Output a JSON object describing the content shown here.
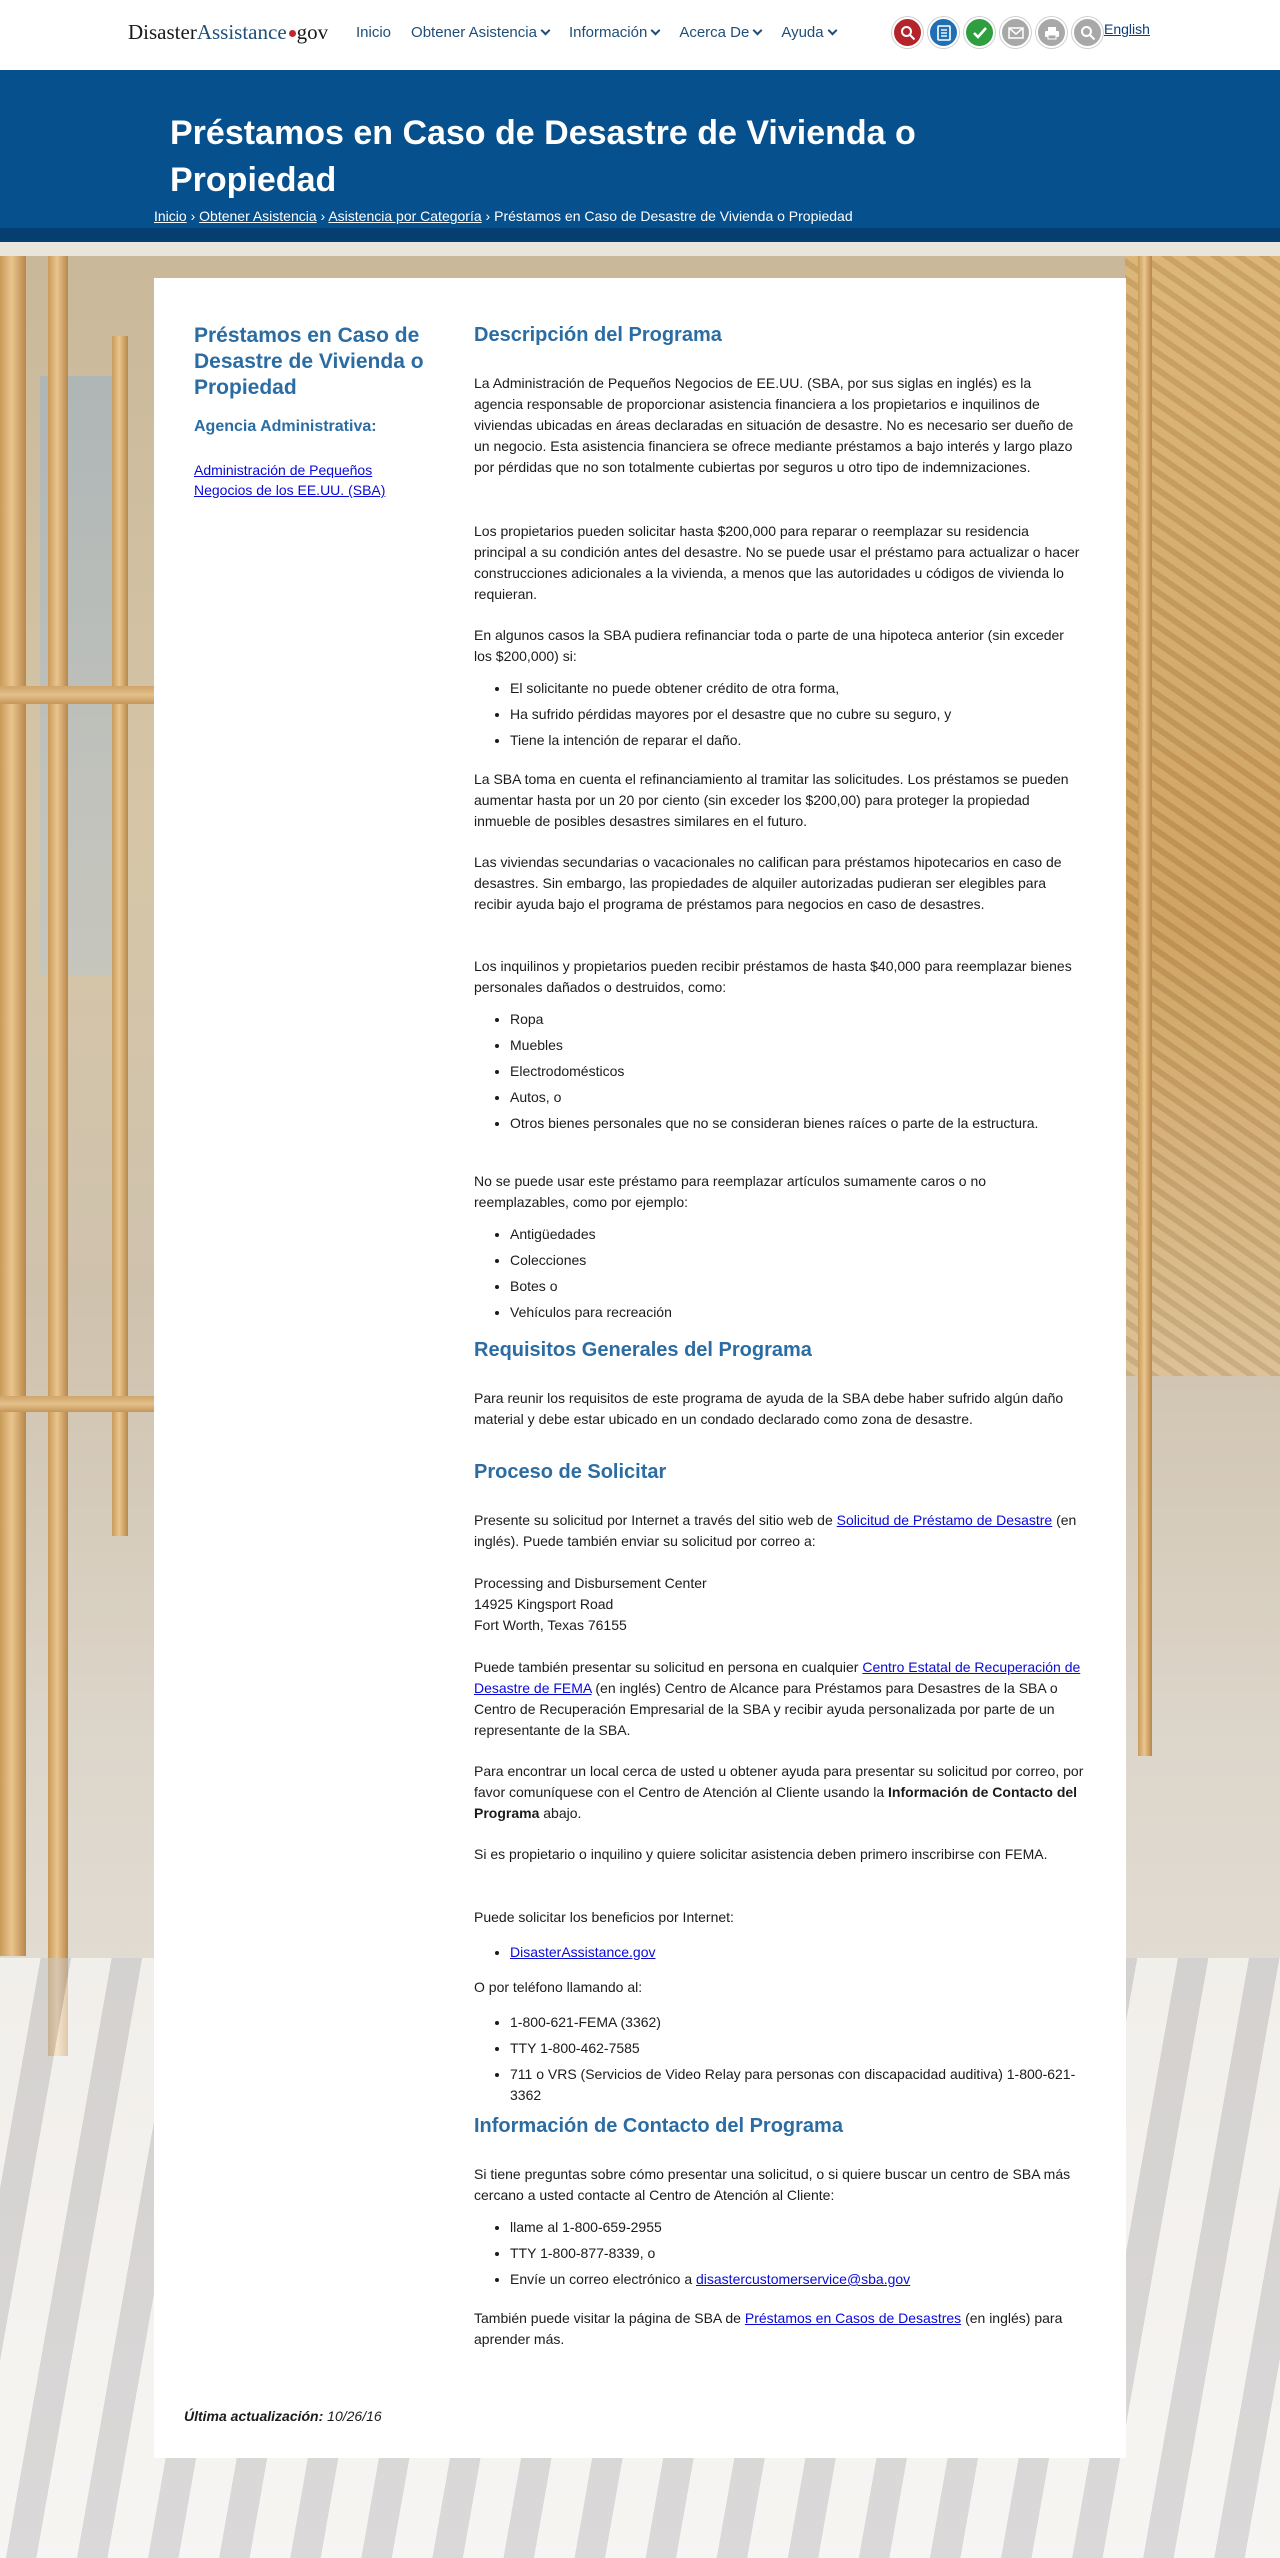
{
  "header": {
    "logo_part1": "Disaster",
    "logo_part2": "Assistance",
    "logo_part3": "gov",
    "nav": [
      "Inicio",
      "Obtener Asistencia",
      "Información",
      "Acerca De",
      "Ayuda"
    ],
    "language_link": "English"
  },
  "hero": {
    "title": "Préstamos en Caso de Desastre de Vivienda o Propiedad",
    "breadcrumb": {
      "home": "Inicio",
      "get_assistance": "Obtener Asistencia",
      "by_category": "Asistencia por Categoría",
      "current": "Préstamos en Caso de Desastre de Vivienda o Propiedad",
      "separator": "›"
    }
  },
  "sidebar": {
    "title": "Préstamos en Caso de Desastre de Vivienda o Propiedad",
    "agency_heading": "Agencia Administrativa:",
    "agency_link": "Administración de Pequeños Negocios de los EE.UU. (SBA)"
  },
  "main": {
    "h_description": "Descripción del Programa",
    "p1": "La Administración de Pequeños Negocios de EE.UU. (SBA, por sus siglas en inglés) es la agencia responsable de proporcionar asistencia financiera a los propietarios e inquilinos de viviendas ubicadas en áreas declaradas en situación de desastre. No es necesario ser dueño de un negocio. Esta asistencia financiera se ofrece mediante préstamos a bajo interés y largo plazo por pérdidas que no son totalmente cubiertas por seguros u otro tipo de indemnizaciones.",
    "p2": "Los propietarios pueden solicitar hasta $200,000 para reparar o reemplazar su residencia principal a su condición antes del desastre. No se puede usar el préstamo para actualizar o hacer construcciones adicionales a la vivienda, a menos que las autoridades u códigos de vivienda lo requieran.",
    "p3": "En algunos casos la SBA pudiera refinanciar toda o parte de una hipoteca anterior (sin exceder los $200,000) si:",
    "list1": [
      "El solicitante no puede obtener crédito de otra forma,",
      "Ha sufrido pérdidas mayores por el desastre que no cubre su seguro, y",
      "Tiene la intención de reparar el daño."
    ],
    "p4": "La SBA toma en cuenta el refinanciamiento al tramitar las solicitudes. Los préstamos se pueden aumentar hasta por un 20 por ciento (sin exceder los $200,00) para proteger la propiedad inmueble de posibles desastres similares en el futuro.",
    "p5": "Las viviendas secundarias o vacacionales no califican para préstamos hipotecarios en caso de desastres. Sin embargo, las propiedades de alquiler autorizadas pudieran ser elegibles para recibir ayuda bajo el programa de préstamos para negocios en caso de desastres.",
    "p6": "Los inquilinos y propietarios pueden recibir préstamos de hasta $40,000 para reemplazar bienes personales dañados o destruidos, como:",
    "list2": [
      "Ropa",
      "Muebles",
      "Electrodomésticos",
      "Autos, o",
      "Otros bienes personales que no se consideran bienes raíces o parte de la estructura."
    ],
    "p7": "No se puede usar este préstamo para reemplazar artículos sumamente caros o no reemplazables, como por ejemplo:",
    "list3": [
      "Antigüedades",
      "Colecciones",
      "Botes o",
      "Vehículos para recreación"
    ],
    "h_requirements": "Requisitos Generales del Programa",
    "p8": "Para reunir los requisitos de este programa de ayuda de la SBA debe haber sufrido algún daño material y debe estar ubicado en un condado declarado como zona de desastre.",
    "h_process": "Proceso de Solicitar",
    "p9_a": "Presente su solicitud por Internet a través del sitio web de ",
    "p9_link": "Solicitud de Préstamo de Desastre",
    "p9_b": " (en inglés). Puede también enviar su solicitud por correo a:",
    "address": [
      "Processing and Disbursement Center",
      "14925 Kingsport Road",
      "Fort Worth, Texas 76155"
    ],
    "p10_a": "Puede también presentar su solicitud en persona en cualquier ",
    "p10_link": "Centro Estatal de Recuperación de Desastre de FEMA",
    "p10_b": " (en inglés) Centro de Alcance para Préstamos para Desastres de la SBA o Centro de Recuperación Empresarial de la SBA y recibir ayuda personalizada por parte de un representante de la SBA.",
    "p11_a": "Para encontrar un local cerca de usted u obtener ayuda para presentar su solicitud por correo, por favor comuníquese con el Centro de Atención al Cliente usando la ",
    "p11_bold": "Información de Contacto del Programa",
    "p11_b": " abajo.",
    "p12": "Si es propietario o inquilino y quiere solicitar asistencia deben primero inscribirse con FEMA.",
    "p13": "Puede solicitar los beneficios por Internet:",
    "online_link": "DisasterAssistance.gov",
    "p14": "O por teléfono llamando al:",
    "list4": [
      "1-800-621-FEMA (3362)",
      "TTY 1-800-462-7585",
      "711 o VRS (Servicios de Video Relay para personas con discapacidad auditiva) 1-800-621-3362"
    ],
    "h_contact": "Información de Contacto del Programa",
    "p15": "Si tiene preguntas sobre cómo presentar una solicitud, o si quiere buscar un centro de SBA más cercano a usted contacte al Centro de Atención al Cliente:",
    "contact_1": "llame al 1-800-659-2955",
    "contact_2": "TTY 1-800-877-8339, o",
    "contact_3_a": "Envíe un correo electrónico a ",
    "contact_3_link": "disastercustomerservice@sba.gov",
    "p16_a": "También puede visitar la página de SBA de ",
    "p16_link": "Préstamos en Casos de Desastres",
    "p16_b": " (en inglés) para aprender más."
  },
  "footer": {
    "updated_label": "Última actualización:",
    "updated_date": "10/26/16"
  }
}
